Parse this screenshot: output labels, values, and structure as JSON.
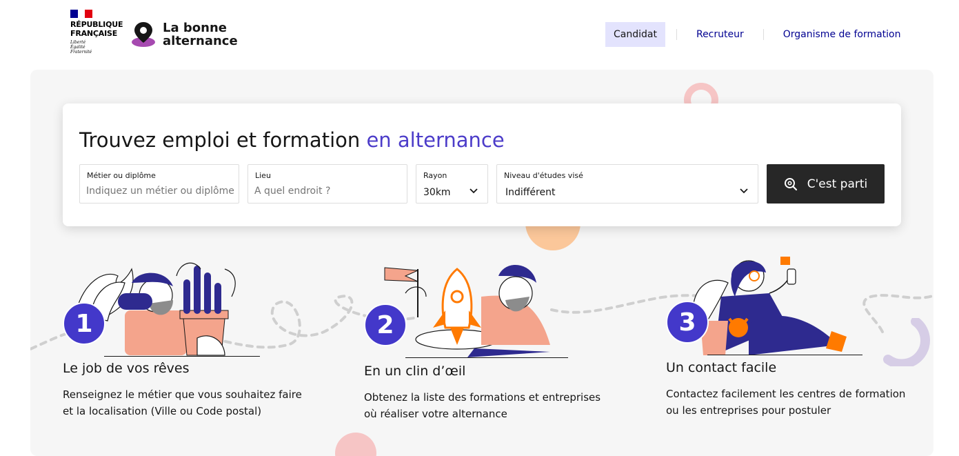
{
  "header": {
    "gov": {
      "line1": "RÉPUBLIQUE",
      "line2": "FRANÇAISE",
      "motto": [
        "Liberté",
        "Égalité",
        "Fraternité"
      ]
    },
    "brand": {
      "line1": "La bonne",
      "line2": "alternance"
    },
    "nav": [
      {
        "label": "Candidat",
        "active": true
      },
      {
        "label": "Recruteur",
        "active": false
      },
      {
        "label": "Organisme de formation",
        "active": false
      }
    ]
  },
  "search": {
    "title_main": "Trouvez emploi et formation ",
    "title_accent": "en alternance",
    "metier": {
      "label": "Métier ou diplôme",
      "placeholder": "Indiquez un métier ou diplôme"
    },
    "lieu": {
      "label": "Lieu",
      "placeholder": "A quel endroit ?"
    },
    "rayon": {
      "label": "Rayon",
      "value": "30km"
    },
    "niveau": {
      "label": "Niveau d'études visé",
      "value": "Indifférent"
    },
    "submit": {
      "label": "C'est parti",
      "icon": "search-icon"
    }
  },
  "steps": [
    {
      "number": "1",
      "title": "Le job de vos rêves",
      "desc": "Renseignez le métier que vous souhaitez faire et la localisation (Ville ou Code postal)"
    },
    {
      "number": "2",
      "title": "En un clin d’œil",
      "desc": "Obtenez la liste des formations et entreprises où réaliser votre alternance"
    },
    {
      "number": "3",
      "title": "Un contact facile",
      "desc": "Contactez facilement les centres de formation ou les entreprises pour postuler"
    }
  ],
  "colors": {
    "accent": "#4c3cc9",
    "badge": "#4338ca",
    "nav": "#000091",
    "button": "#272727",
    "orange": "#ff7a00",
    "salmon": "#f4a48c"
  }
}
